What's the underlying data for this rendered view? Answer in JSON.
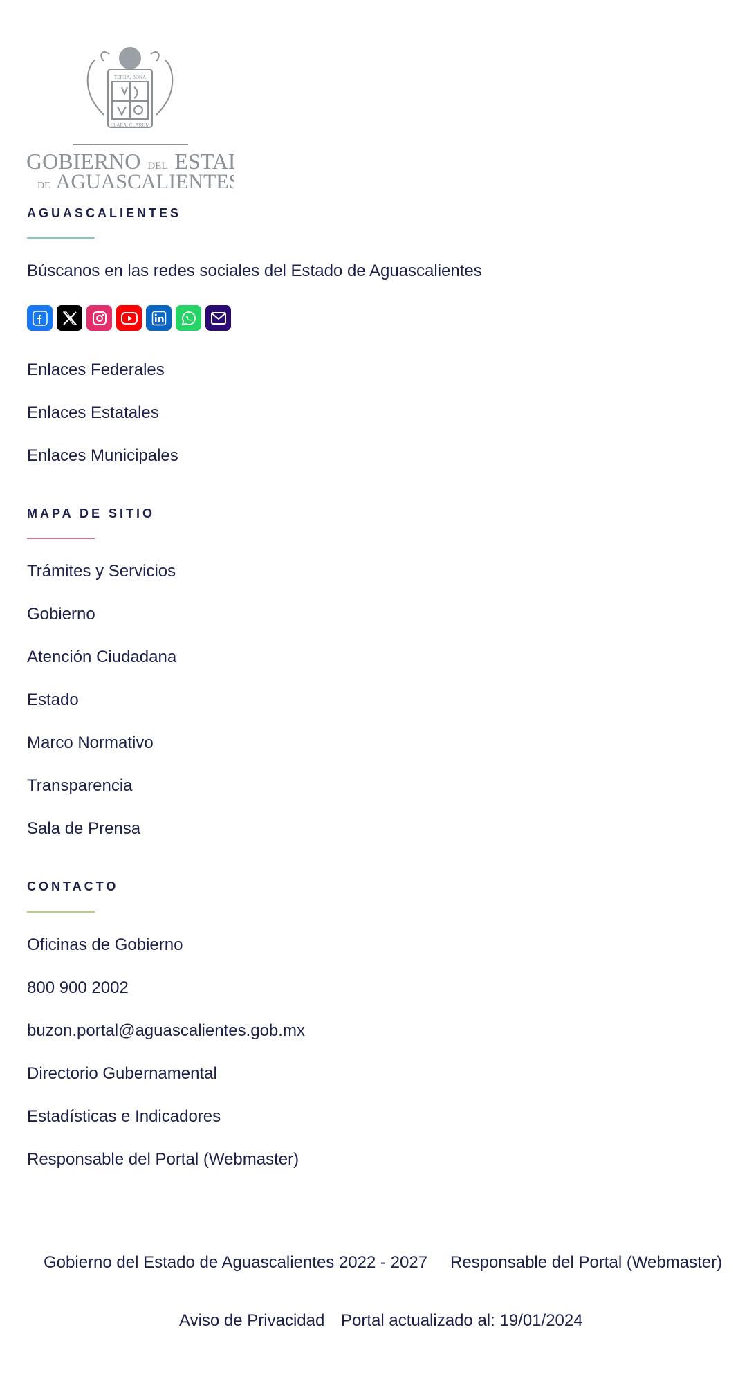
{
  "logo": {
    "line1": "GOBIERNO",
    "line1_small": "DEL",
    "line1_end": "ESTADO",
    "line2_small": "DE",
    "line2": "AGUASCALIENTES",
    "seal_top": "TERRA, BONA",
    "seal_bottom": "CLARA, CLARUM"
  },
  "aguascalientes": {
    "title": "AGUASCALIENTES",
    "accent": "#7fcfc6",
    "description": "Búscanos en las redes sociales del Estado de Aguascalientes",
    "social": [
      {
        "name": "facebook-icon",
        "color": "#1877f2"
      },
      {
        "name": "x-icon",
        "color": "#000000"
      },
      {
        "name": "instagram-icon",
        "color": "#e1306c"
      },
      {
        "name": "youtube-icon",
        "color": "#ff0000"
      },
      {
        "name": "linkedin-icon",
        "color": "#0a66c2"
      },
      {
        "name": "whatsapp-icon",
        "color": "#25d366"
      },
      {
        "name": "email-icon",
        "color": "#2b0a73"
      }
    ],
    "links": [
      "Enlaces Federales",
      "Enlaces Estatales",
      "Enlaces Municipales"
    ]
  },
  "mapa": {
    "title": "MAPA DE SITIO",
    "accent": "#c8749a",
    "links": [
      "Trámites y Servicios",
      "Gobierno",
      "Atención Ciudadana",
      "Estado",
      "Marco Normativo",
      "Transparencia",
      "Sala de Prensa"
    ]
  },
  "contacto": {
    "title": "CONTACTO",
    "accent": "#b5d07a",
    "links": [
      "Oficinas de Gobierno",
      "800 900 2002",
      "buzon.portal@aguascalientes.gob.mx",
      "Directorio Gubernamental",
      "Estadísticas e Indicadores",
      "Responsable del Portal (Webmaster)"
    ]
  },
  "footer": {
    "copyright": "Gobierno del Estado de Aguascalientes 2022 - 2027",
    "webmaster": "Responsable del Portal (Webmaster)",
    "privacy": "Aviso de Privacidad",
    "updated": "Portal actualizado al: 19/01/2024"
  }
}
